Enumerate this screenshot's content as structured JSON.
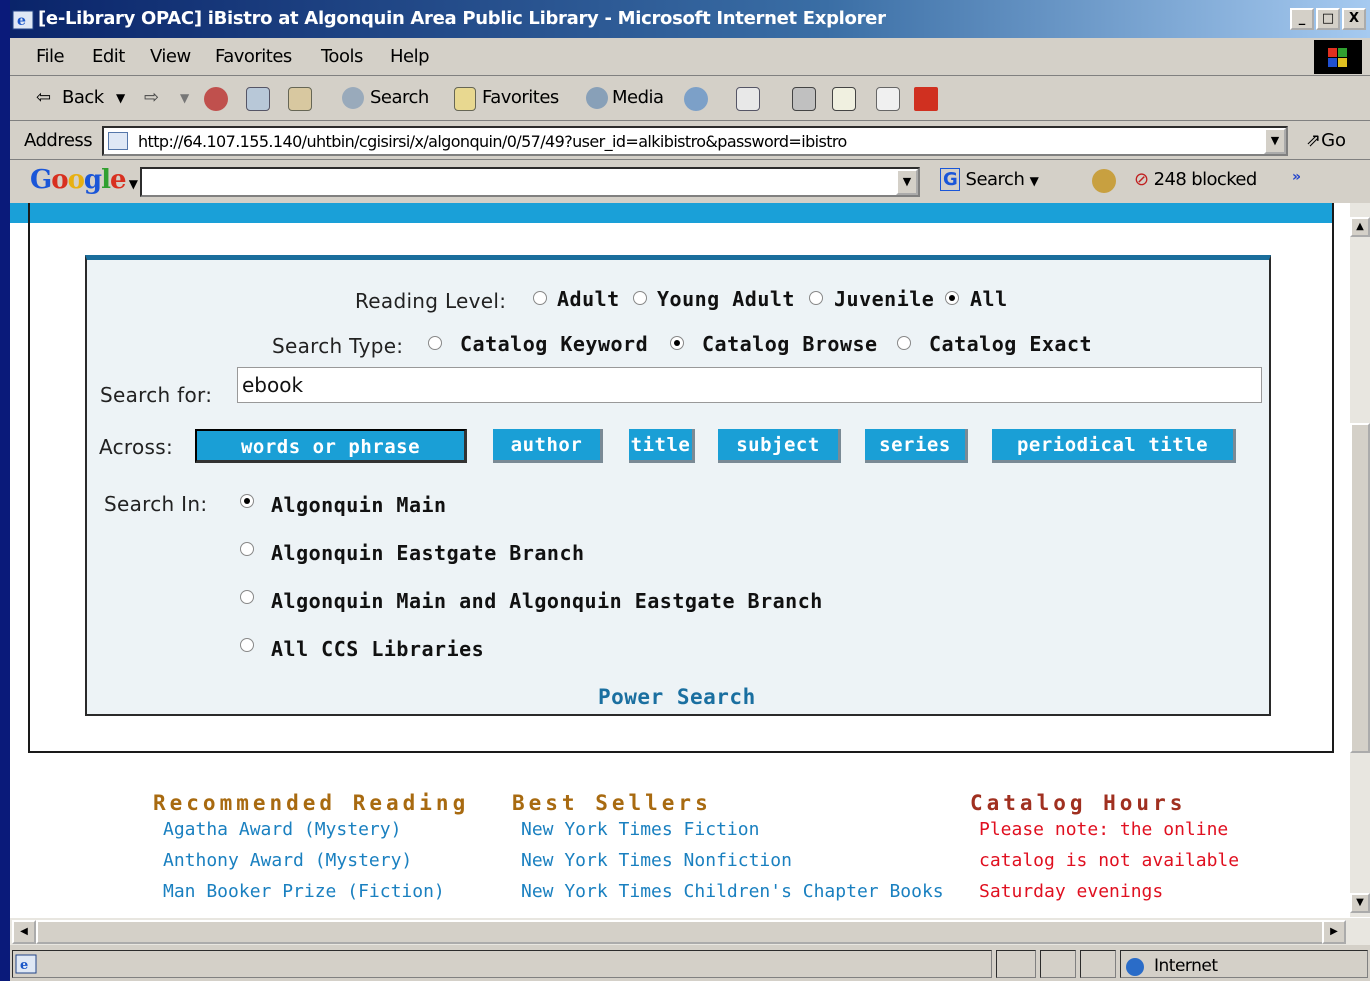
{
  "window": {
    "title": "[e-Library OPAC] iBistro at Algonquin Area Public Library - Microsoft Internet Explorer",
    "controls": [
      "_",
      "□",
      "X"
    ]
  },
  "menu": {
    "file": "File",
    "edit": "Edit",
    "view": "View",
    "favorites": "Favorites",
    "tools": "Tools",
    "help": "Help"
  },
  "toolbar": {
    "back": "Back",
    "search": "Search",
    "favorites": "Favorites",
    "media": "Media"
  },
  "address": {
    "label": "Address",
    "url": "http://64.107.155.140/uhtbin/cgisirsi/x/algonquin/0/57/49?user_id=alkibistro&password=ibistro",
    "go": "Go"
  },
  "googlebar": {
    "logo": "Google",
    "search_label": "Search",
    "blocked": "248 blocked",
    "more": "»"
  },
  "form": {
    "reading_level_label": "Reading Level:",
    "reading_levels": [
      {
        "label": "Adult",
        "selected": false
      },
      {
        "label": "Young Adult",
        "selected": false
      },
      {
        "label": "Juvenile",
        "selected": false
      },
      {
        "label": "All",
        "selected": true
      }
    ],
    "search_type_label": "Search Type:",
    "search_types": [
      {
        "label": "Catalog Keyword",
        "selected": false
      },
      {
        "label": "Catalog Browse",
        "selected": true
      },
      {
        "label": "Catalog Exact",
        "selected": false
      }
    ],
    "search_for_label": "Search for:",
    "search_for_value": "ebook",
    "across_label": "Across:",
    "across_buttons": [
      "words or phrase",
      "author",
      "title",
      "subject",
      "series",
      "periodical title"
    ],
    "search_in_label": "Search In:",
    "libraries": [
      {
        "label": "Algonquin Main",
        "selected": true
      },
      {
        "label": "Algonquin Eastgate Branch",
        "selected": false
      },
      {
        "label": "Algonquin Main and Algonquin Eastgate Branch",
        "selected": false
      },
      {
        "label": "All CCS Libraries",
        "selected": false
      }
    ],
    "power_search": "Power Search"
  },
  "columns": {
    "recommended": {
      "heading": "Recommended Reading",
      "links": [
        "Agatha Award (Mystery)",
        "Anthony Award (Mystery)",
        "Man Booker Prize (Fiction)"
      ]
    },
    "bestsellers": {
      "heading": "Best Sellers",
      "links": [
        "New York Times Fiction",
        "New York Times Nonfiction",
        "New York Times Children's Chapter Books"
      ]
    },
    "hours": {
      "heading": "Catalog Hours",
      "note_lines": [
        "Please note: the online",
        "catalog is not available",
        "Saturday evenings"
      ]
    }
  },
  "status": {
    "zone": "Internet"
  },
  "colors": {
    "accent": "#1a9fd6",
    "heading_gold": "#a86a10",
    "heading_red": "#a03020",
    "link": "#1a80c0",
    "note_red": "#e01020"
  }
}
